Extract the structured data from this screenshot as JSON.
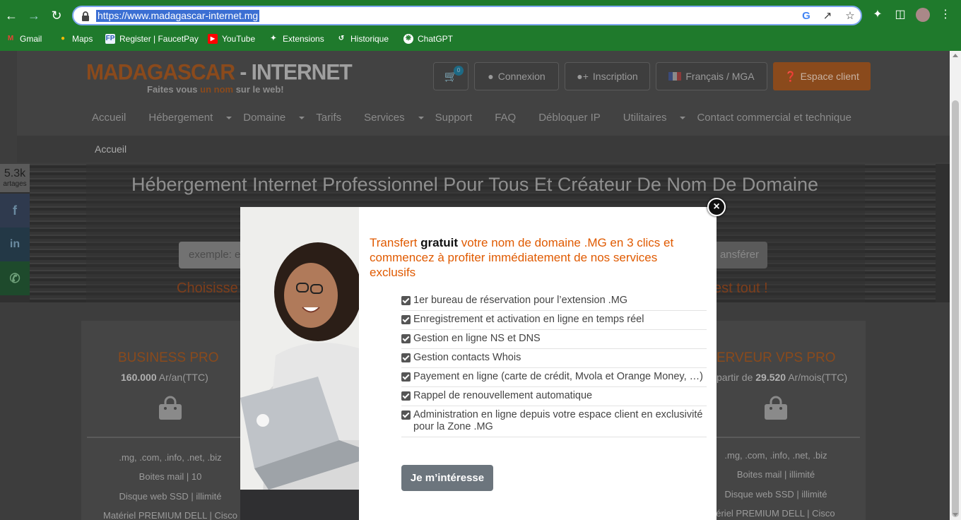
{
  "browser": {
    "url": "https://www.madagascar-internet.mg",
    "bookmarks": [
      {
        "label": "Gmail",
        "icon": "gmail-icon"
      },
      {
        "label": "Maps",
        "icon": "maps-icon"
      },
      {
        "label": "Register | FaucetPay",
        "icon": "faucetpay-icon"
      },
      {
        "label": "YouTube",
        "icon": "youtube-icon"
      },
      {
        "label": "Extensions",
        "icon": "puzzle-icon"
      },
      {
        "label": "Historique",
        "icon": "history-icon"
      },
      {
        "label": "ChatGPT",
        "icon": "chatgpt-icon"
      }
    ]
  },
  "site": {
    "logo_part1": "MADAGASCAR",
    "logo_sep": " - ",
    "logo_part2": "INTERNET",
    "tagline_a": "Faites vous ",
    "tagline_hl": "un nom",
    "tagline_b": " sur le web!",
    "cart_count": "0",
    "login": "Connexion",
    "signup": "Inscription",
    "language": "Français / MGA",
    "client_area": "Espace client",
    "menu": [
      {
        "label": "Accueil",
        "dropdown": false
      },
      {
        "label": "Hébergement",
        "dropdown": true
      },
      {
        "label": "Domaine",
        "dropdown": true
      },
      {
        "label": "Tarifs",
        "dropdown": false
      },
      {
        "label": "Services",
        "dropdown": true
      },
      {
        "label": "Support",
        "dropdown": false
      },
      {
        "label": "FAQ",
        "dropdown": false
      },
      {
        "label": "Débloquer IP",
        "dropdown": false
      },
      {
        "label": "Utilitaires",
        "dropdown": true
      },
      {
        "label": "Contact commercial et technique",
        "dropdown": false
      }
    ],
    "breadcrumb": "Accueil"
  },
  "hero": {
    "title": "Hébergement Internet Professionnel Pour Tous Et Créateur De Nom De Domaine",
    "search_visible": "exemple: e",
    "button_visible": "ansférer",
    "cta_left_visible": "Choisisse",
    "cta_right_visible": "est tout !"
  },
  "share": {
    "count": "5.3k",
    "label": "artages"
  },
  "cards": {
    "left": {
      "title": "BUSINESS PRO",
      "price_value": "160.000",
      "price_unit": " Ar/an(TTC)",
      "lines": [
        ".mg, .com, .info, .net, .biz",
        "Boites mail | 10",
        "Disque web SSD | illimité",
        "Matériel PREMIUM DELL | Cisco"
      ]
    },
    "right": {
      "title": "ERVEUR VPS PRO",
      "price_prefix": "partir de ",
      "price_value": "29.520",
      "price_unit": " Ar/mois(TTC)",
      "lines": [
        ".mg, .com, .info, .net, .biz",
        "Boites mail | illimité",
        "Disque web SSD | illimité",
        "atériel PREMIUM DELL | Cisco"
      ]
    }
  },
  "modal": {
    "heading_a": "Transfert ",
    "heading_bold": "gratuit",
    "heading_b": " votre nom de domaine .MG en 3 clics et commencez à profiter immédiatement de nos services exclusifs",
    "features": [
      "1er bureau de réservation pour l’extension .MG",
      "Enregistrement et activation en ligne en temps réel",
      "Gestion en ligne NS et DNS",
      "Gestion contacts Whois",
      "Payement en ligne (carte de crédit, Mvola et Orange Money, …)",
      "Rappel de renouvellement automatique",
      "Administration en ligne depuis votre espace client en exclusivité pour la Zone .MG"
    ],
    "cta": "Je m’intéresse",
    "close": "×"
  },
  "colors": {
    "chrome": "#1f7a2c",
    "accent_orange": "#e05a00",
    "brand_brown": "#8a4a1c"
  }
}
